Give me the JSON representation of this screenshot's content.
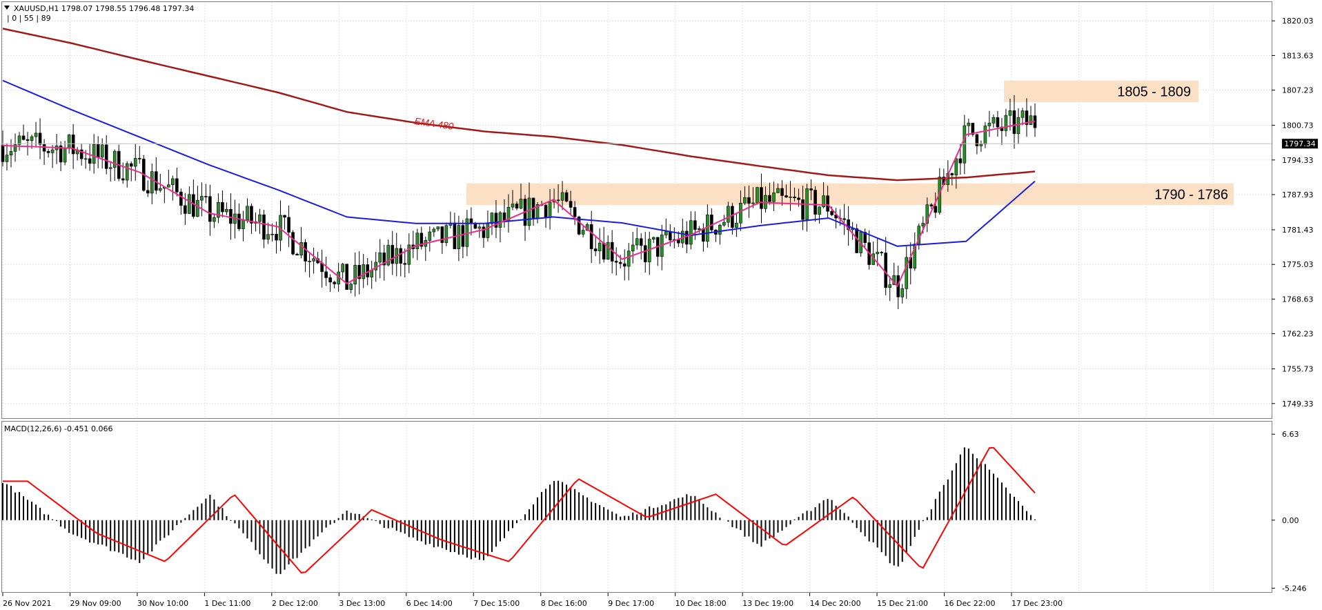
{
  "header": {
    "symbol_line": "XAUUSD,H1  1798.07 1798.55 1796.48 1797.34",
    "indicator_line": "| 0 | 55 | 89",
    "macd_line": "MACD(12,26,6) -0.451 0.066"
  },
  "price_axis": {
    "ticks": [
      "1820.03",
      "1813.63",
      "1807.23",
      "1800.73",
      "1794.33",
      "1787.93",
      "1781.43",
      "1775.03",
      "1768.63",
      "1762.23",
      "1755.73",
      "1749.33"
    ],
    "current_price": "1797.34"
  },
  "macd_axis": {
    "ticks": [
      "6.63",
      "0.00",
      "-5.246"
    ]
  },
  "time_axis": {
    "ticks": [
      "26 Nov 2021",
      "29 Nov 09:00",
      "30 Nov 10:00",
      "1 Dec 11:00",
      "2 Dec 12:00",
      "3 Dec 13:00",
      "6 Dec 14:00",
      "7 Dec 15:00",
      "8 Dec 16:00",
      "9 Dec 17:00",
      "10 Dec 18:00",
      "13 Dec 19:00",
      "14 Dec 20:00",
      "15 Dec 21:00",
      "16 Dec 22:00",
      "17 Dec 23:00"
    ]
  },
  "annotations": {
    "ema_label": "EMA 480",
    "zone_upper": "1805 - 1809",
    "zone_lower": "1790 - 1786"
  },
  "colors": {
    "ema480": "#a11919",
    "ema_blue": "#1a1ae6",
    "ema_pink": "#ee2b8c",
    "zone": "#fbe0c6",
    "macd_signal": "#ff0000",
    "grid": "#e3e3e3"
  },
  "chart_data": {
    "type": "line",
    "title": "XAUUSD,H1",
    "ylim": [
      1746.5,
      1823.5
    ],
    "x": [
      "26 Nov 2021",
      "29 Nov 09:00",
      "30 Nov 10:00",
      "1 Dec 11:00",
      "2 Dec 12:00",
      "3 Dec 13:00",
      "6 Dec 14:00",
      "7 Dec 15:00",
      "8 Dec 16:00",
      "9 Dec 17:00",
      "10 Dec 18:00",
      "13 Dec 19:00",
      "14 Dec 20:00",
      "15 Dec 21:00",
      "16 Dec 22:00",
      "17 Dec 23:00"
    ],
    "series": [
      {
        "name": "EMA 480",
        "values": [
          1818.6,
          1815.9,
          1812.8,
          1809.8,
          1806.8,
          1803.2,
          1801.2,
          1799.6,
          1798.6,
          1797.1,
          1795.0,
          1793.2,
          1791.5,
          1790.6,
          1791.1,
          1792.2
        ]
      },
      {
        "values": [
          1809.0,
          1803.6,
          1798.5,
          1793.4,
          1788.8,
          1783.8,
          1782.6,
          1782.6,
          1783.8,
          1782.7,
          1780.4,
          1782.2,
          1783.6,
          1778.4,
          1779.3,
          1790.4
        ]
      },
      {
        "values": [
          1797.0,
          1796.5,
          1792.0,
          1784.5,
          1782.0,
          1771.5,
          1778.5,
          1781.5,
          1787.0,
          1776.0,
          1780.5,
          1786.5,
          1786.0,
          1771.0,
          1799.0,
          1801.5
        ]
      }
    ],
    "macd": {
      "ylim": [
        -5.246,
        6.63
      ]
    }
  }
}
